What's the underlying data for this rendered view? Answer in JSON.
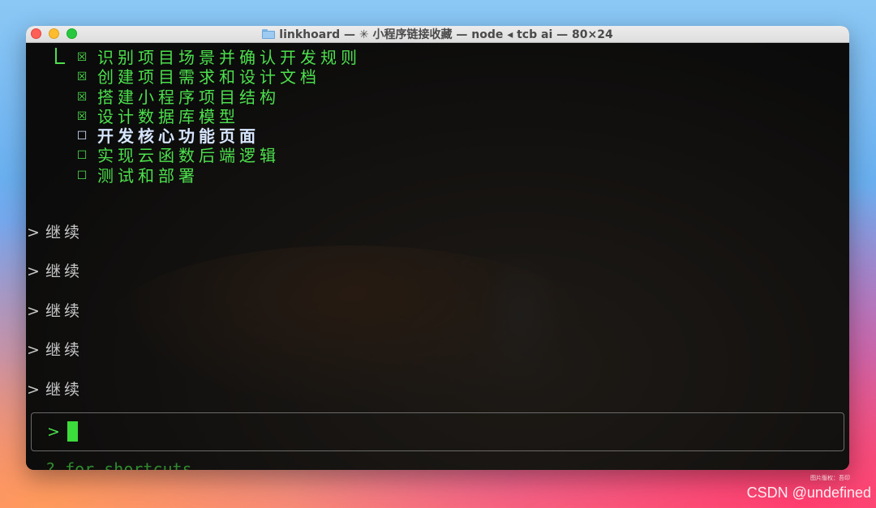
{
  "window": {
    "title": "linkhoard — ✳ 小程序链接收藏 — node ◂ tcb ai — 80×24"
  },
  "tasks": [
    {
      "check": "☒",
      "label": "识别项目场景并确认开发规则"
    },
    {
      "check": "☒",
      "label": "创建项目需求和设计文档"
    },
    {
      "check": "☒",
      "label": "搭建小程序项目结构"
    },
    {
      "check": "☒",
      "label": "设计数据库模型"
    },
    {
      "check": "☐",
      "label": "开发核心功能页面"
    },
    {
      "check": "☐",
      "label": "实现云函数后端逻辑"
    },
    {
      "check": "☐",
      "label": "测试和部署"
    }
  ],
  "history": [
    {
      "caret": ">",
      "text": "继续"
    },
    {
      "caret": ">",
      "text": "继续"
    },
    {
      "caret": ">",
      "text": "继续"
    },
    {
      "caret": ">",
      "text": "继续"
    },
    {
      "caret": ">",
      "text": "继续"
    }
  ],
  "input": {
    "prompt": ">"
  },
  "footer": {
    "hint": "? for shortcuts"
  },
  "watermarks": {
    "small": "图片版权：吾印",
    "main": "CSDN @undefined"
  },
  "colors": {
    "terminal_green": "#4de04d",
    "current_task": "#d7e6ff",
    "close": "#ff5f57",
    "minimize": "#febc2e",
    "maximize": "#28c840"
  },
  "icons": {
    "title": "folder-icon"
  }
}
